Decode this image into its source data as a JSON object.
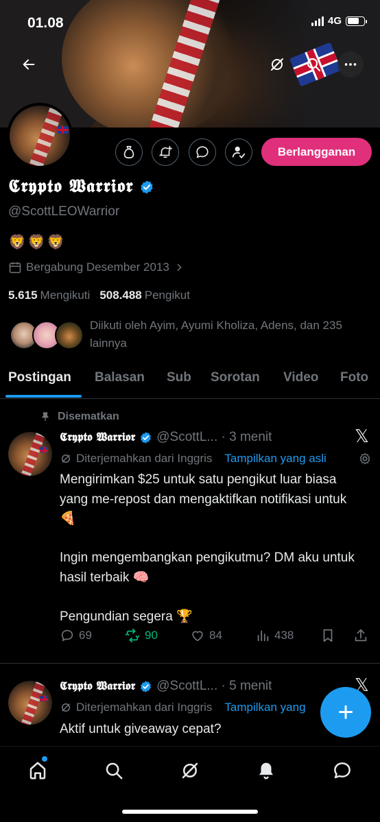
{
  "status_bar": {
    "time": "01.08",
    "network": "4G"
  },
  "profile": {
    "display_name": "𝕮𝖗𝖞𝖕𝖙𝖔 𝖂𝖆𝖗𝖗𝖎𝖔𝖗",
    "handle": "@ScottLEOWarrior",
    "bio": "🦁🦁🦁",
    "joined": "Bergabung Desember 2013",
    "following_count": "5.615",
    "following_label": "Mengikuti",
    "followers_count": "508.488",
    "followers_label": "Pengikut",
    "followed_by": "Diikuti oleh Ayim, Ayumi Kholiza, Adens, dan 235 lainnya",
    "subscribe_label": "Berlangganan"
  },
  "tabs": [
    {
      "label": "Postingan",
      "active": true
    },
    {
      "label": "Balasan"
    },
    {
      "label": "Sub"
    },
    {
      "label": "Sorotan"
    },
    {
      "label": "Video"
    },
    {
      "label": "Foto"
    }
  ],
  "posts": [
    {
      "pinned_label": "Disematkan",
      "author": "𝕮𝖗𝖞𝖕𝖙𝖔 𝖂𝖆𝖗𝖗𝖎𝖔𝖗",
      "handle_time": "@ScottL... · 3 menit",
      "translated": "Diterjemahkan dari Inggris",
      "show_original": "Tampilkan yang asli",
      "text": "Mengirimkan $25 untuk satu pengikut luar biasa yang me-repost dan mengaktifkan notifikasi untuk 🍕\n\nIngin mengembangkan pengikutmu? DM aku untuk hasil terbaik 🧠\n\nPengundian segera 🏆",
      "replies": "69",
      "reposts": "90",
      "likes": "84",
      "views": "438"
    },
    {
      "author": "𝕮𝖗𝖞𝖕𝖙𝖔 𝖂𝖆𝖗𝖗𝖎𝖔𝖗",
      "handle_time": "@ScottL... · 5 menit",
      "translated": "Diterjemahkan dari Inggris",
      "show_original": "Tampilkan yang",
      "text": "Aktif untuk giveaway cepat?"
    }
  ],
  "fab_label": "+",
  "colors": {
    "accent": "#1d9bf0",
    "subscribe": "#e0307c",
    "repost_active": "#00ba7c"
  }
}
